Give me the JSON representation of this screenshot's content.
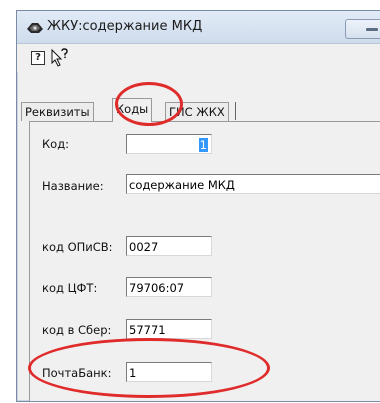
{
  "window": {
    "title": "ЖКУ:содержание МКД"
  },
  "toolbar": {
    "help_glyph": "?"
  },
  "tabs": [
    {
      "label": "Реквизиты",
      "active": false
    },
    {
      "label": "Коды",
      "active": true
    },
    {
      "label": "ГИС ЖКХ",
      "active": false
    }
  ],
  "form": {
    "code": {
      "label": "Код:",
      "value": "1"
    },
    "name": {
      "label": "Название:",
      "value": "содержание МКД"
    },
    "opsv": {
      "label": "код ОПиСВ:",
      "value": "0027"
    },
    "cft": {
      "label": "код ЦФТ:",
      "value": "79706:07"
    },
    "sber": {
      "label": "код в Сбер:",
      "value": "57771"
    },
    "pochtabank": {
      "label": "ПочтаБанк:",
      "value": "1"
    }
  },
  "colors": {
    "annotation": "#e02b2b",
    "selection": "#3399ff"
  }
}
